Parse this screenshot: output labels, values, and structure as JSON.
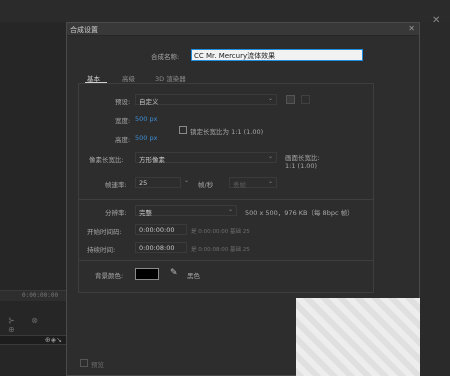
{
  "dialog": {
    "title": "合成设置",
    "name_label": "合成名称:",
    "name_value": "CC Mr. Mercury流体效果",
    "tabs": [
      {
        "label": "基本",
        "active": true
      },
      {
        "label": "高级",
        "active": false
      },
      {
        "label": "3D 渲染器",
        "active": false
      }
    ],
    "preset_label": "预设:",
    "preset_value": "自定义",
    "width_label": "宽度:",
    "width_value": "500 px",
    "height_label": "高度:",
    "height_value": "500 px",
    "lock_label": "锁定长宽比为 1:1 (1.00)",
    "par_label": "像素长宽比:",
    "par_value": "方形像素",
    "frame_aspect_label": "画面长宽比:",
    "frame_aspect_value": "1:1 (1.00)",
    "fps_label": "帧速率:",
    "fps_value": "25",
    "fps_unit": "帧/秒",
    "fps_drop": "丢帧",
    "resolution_label": "分辨率:",
    "resolution_value": "完整",
    "resolution_info": "500 x 500，976 KB（每 8bpc 帧）",
    "start_label": "开始时间码:",
    "start_value": "0:00:00:00",
    "start_note": "是 0:00:00:00  基础 25",
    "duration_label": "持续时间:",
    "duration_value": "0:00:08:00",
    "duration_note": "是 0:00:08:00  基础 25",
    "bg_label": "背景颜色:",
    "bg_color": "#000000",
    "bg_color_name": "黑色",
    "preview_label": "预览"
  },
  "background": {
    "timecode": "0:00:00:00",
    "strip_icons": "⊕◈↘"
  },
  "colors": {
    "accent": "#1e8fe0",
    "link_blue": "#3c8ed6",
    "panel": "#2d2d2d"
  }
}
